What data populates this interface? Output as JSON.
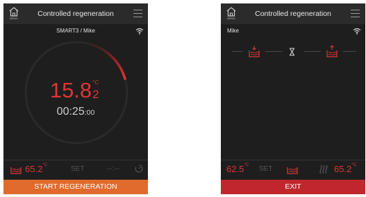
{
  "screen_left": {
    "header": {
      "home_label": "MENU",
      "title": "Controlled regeneration"
    },
    "subtitle": "SMART3 / Mike",
    "temperature": {
      "integer": "15.8",
      "decimal": "2",
      "unit": "°C"
    },
    "timer": {
      "main": "00:25",
      "seconds": ":00"
    },
    "bottom": {
      "current_temp": "65.2",
      "unit": "°C",
      "set_label": "SET",
      "timer_placeholder": "--:--"
    },
    "action_button": "START REGENERATION",
    "colors": {
      "accent": "#e03535",
      "button": "#e06b2c"
    }
  },
  "screen_right": {
    "header": {
      "home_label": "MENU",
      "title": "Controlled regeneration"
    },
    "user": "Mike",
    "bottom": {
      "set_temp": "62.5",
      "set_unit": "°C",
      "set_label": "SET",
      "current_temp": "65.2",
      "current_unit": "°C"
    },
    "action_button": "EXIT",
    "colors": {
      "accent": "#e03535",
      "button": "#c0272d"
    }
  }
}
